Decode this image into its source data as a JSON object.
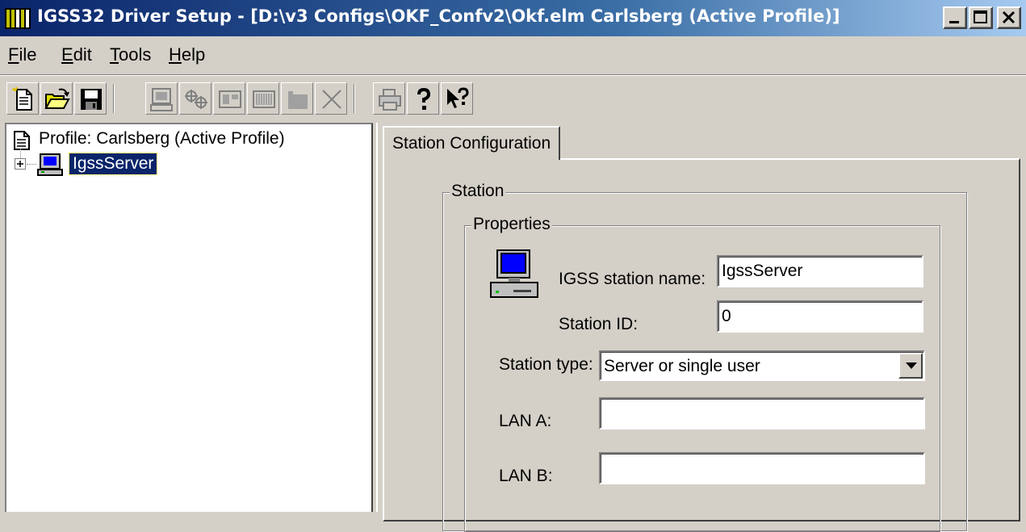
{
  "window": {
    "title": "IGSS32 Driver Setup - [D:\\v3 Configs\\OKF_Confv2\\Okf.elm  Carlsberg (Active Profile)]",
    "icon": "app-icon",
    "controls": [
      "minimize-icon",
      "maximize-icon",
      "close-icon"
    ]
  },
  "menu": {
    "file": {
      "hotkey": "F",
      "rest": "ile"
    },
    "edit": {
      "hotkey": "E",
      "rest": "dit"
    },
    "tools": {
      "hotkey": "T",
      "rest": "ools"
    },
    "help": {
      "hotkey": "H",
      "rest": "elp"
    }
  },
  "toolbar": {
    "buttons": [
      {
        "icon": "new-document-icon",
        "enabled": true
      },
      {
        "icon": "open-folder-icon",
        "enabled": true
      },
      {
        "icon": "save-icon",
        "enabled": true
      },
      {
        "icon": "add-station-icon",
        "enabled": false
      },
      {
        "icon": "add-driver-icon",
        "enabled": false
      },
      {
        "icon": "add-interface-icon",
        "enabled": false
      },
      {
        "icon": "add-rack-icon",
        "enabled": false
      },
      {
        "icon": "add-module-icon",
        "enabled": false
      },
      {
        "icon": "delete-icon",
        "enabled": false
      },
      {
        "icon": "print-icon",
        "enabled": false
      },
      {
        "icon": "help-icon",
        "enabled": true
      },
      {
        "icon": "context-help-icon",
        "enabled": true
      }
    ]
  },
  "tree": {
    "root_label": "Profile: Carlsberg (Active Profile)",
    "node_label": "IgssServer",
    "expander": "+"
  },
  "tabs": {
    "active": "Station Configuration"
  },
  "station": {
    "group_label": "Station",
    "properties_label": "Properties",
    "name_label": "IGSS station name:",
    "name_value": "IgssServer",
    "id_label": "Station ID:",
    "id_value": "0",
    "type_label": "Station type:",
    "type_value": "Server or single user",
    "lan_a_label": "LAN A:",
    "lan_a_value": "",
    "lan_b_label": "LAN B:",
    "lan_b_value": ""
  },
  "colors": {
    "title_start": "#0a246a",
    "title_end": "#a6caf0",
    "selection": "#0a246a",
    "face": "#d4d0c8"
  }
}
